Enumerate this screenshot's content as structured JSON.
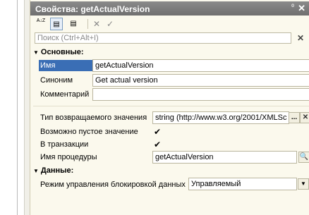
{
  "window": {
    "title": "Свойства: getActualVersion",
    "pin_glyph": "⁰",
    "close_glyph": "✕"
  },
  "toolbar": {
    "sort_label": "A↓Z",
    "categorized_glyph": "▤",
    "filter_glyph": "▤",
    "clear_glyph": "✕",
    "apply_glyph": "✓"
  },
  "search": {
    "placeholder": "Поиск (Ctrl+Alt+I)",
    "clear_glyph": "✕"
  },
  "sections": {
    "main": {
      "title": "Основные:",
      "arrow": "▼"
    },
    "data": {
      "title": "Данные:",
      "arrow": "▼"
    }
  },
  "props": {
    "name": {
      "label": "Имя",
      "value": "getActualVersion"
    },
    "synonym": {
      "label": "Синоним",
      "value": "Get actual version"
    },
    "comment": {
      "label": "Комментарий",
      "value": ""
    },
    "return_type": {
      "label": "Тип возвращаемого значения",
      "value": "string (http://www.w3.org/2001/XMLSc",
      "button": "..."
    },
    "nullable": {
      "label": "Возможно пустое значение",
      "checked": "✔"
    },
    "transaction": {
      "label": "В транзакции",
      "checked": "✔"
    },
    "procedure": {
      "label": "Имя процедуры",
      "value": "getActualVersion",
      "search_glyph": "🔍"
    },
    "lock_mode": {
      "label": "Режим управления блокировкой данных",
      "value": "Управляемый",
      "arrow": "▼"
    }
  }
}
